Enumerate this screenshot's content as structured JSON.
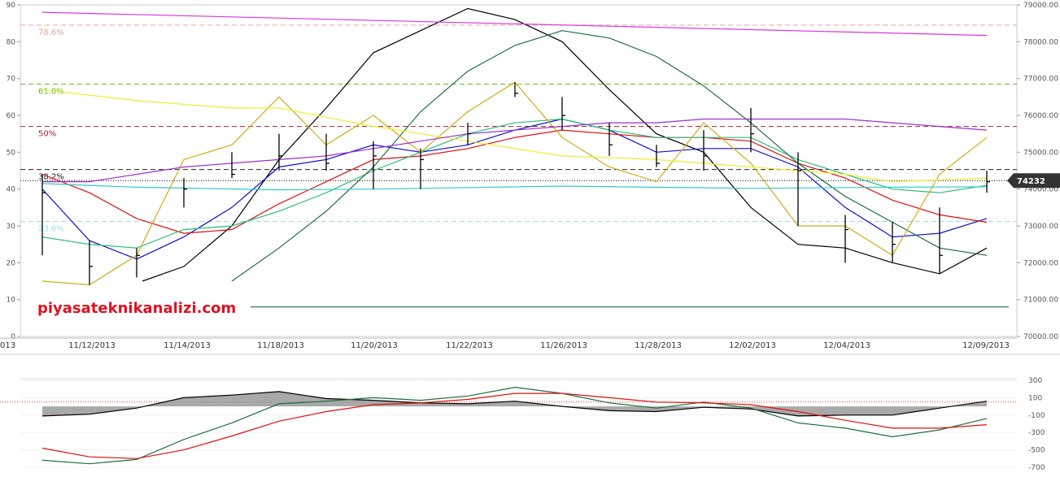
{
  "watermark": "piyasateknikanalizi.com",
  "current_price_label": "74232",
  "colors": {
    "black": "#000000",
    "blue": "#1010cc",
    "red": "#dd1111",
    "seagreen": "#2bbf7a",
    "darkgreen": "#1e6e3e",
    "gold": "#d4aa1a",
    "yellow": "#eeee33",
    "purple": "#9933cc",
    "magenta": "#dd33dd",
    "cyan": "#33cccc"
  },
  "chart_data": [
    {
      "type": "line",
      "panel": "main",
      "x_labels": [
        "013",
        "11/12/2013",
        "11/14/2013",
        "11/18/2013",
        "11/20/2013",
        "11/22/2013",
        "11/26/2013",
        "11/28/2013",
        "12/02/2013",
        "12/04/2013",
        "12/09/2013"
      ],
      "left_axis": {
        "range": [
          0,
          90
        ],
        "ticks": [
          "0",
          "10",
          "20",
          "30",
          "40",
          "50",
          "60",
          "70",
          "80",
          "90"
        ]
      },
      "right_axis": {
        "range": [
          70000,
          79000
        ],
        "ticks": [
          "70000.00",
          "71000.00",
          "72000.00",
          "73000.00",
          "74000.00",
          "75000.00",
          "76000.00",
          "77000.00",
          "78000.00",
          "79000.00"
        ]
      },
      "fib_levels": [
        {
          "label": "78.6%",
          "value": 84.5,
          "color": "#f0a0a0"
        },
        {
          "label": "61.8%",
          "value": 68.5,
          "color": "#66bb22"
        },
        {
          "label": "50%",
          "value": 57.0,
          "color": "#aa2233"
        },
        {
          "label": "38.2%",
          "value": 45.3,
          "color": "#222222"
        },
        {
          "label": "23.6%",
          "value": 31.2,
          "color": "#99ddee"
        }
      ],
      "current_price_level": 42.3,
      "candles": [
        {
          "x": 52,
          "high": 44,
          "low": 22,
          "close": 39
        },
        {
          "x": 110,
          "high": 26,
          "low": 14,
          "close": 19
        },
        {
          "x": 168,
          "high": 24,
          "low": 16,
          "close": 22
        },
        {
          "x": 226,
          "high": 43,
          "low": 35,
          "close": 40
        },
        {
          "x": 285,
          "high": 50,
          "low": 43,
          "close": 44
        },
        {
          "x": 343,
          "high": 55,
          "low": 45,
          "close": 49
        },
        {
          "x": 401,
          "high": 55,
          "low": 45,
          "close": 47
        },
        {
          "x": 459,
          "high": 53,
          "low": 40,
          "close": 49
        },
        {
          "x": 517,
          "high": 51,
          "low": 40,
          "close": 48
        },
        {
          "x": 575,
          "high": 58,
          "low": 52,
          "close": 55
        },
        {
          "x": 633,
          "high": 69,
          "low": 65,
          "close": 66
        },
        {
          "x": 691,
          "high": 65,
          "low": 56,
          "close": 60
        },
        {
          "x": 749,
          "high": 58,
          "low": 49,
          "close": 52
        },
        {
          "x": 807,
          "high": 52,
          "low": 46,
          "close": 47
        },
        {
          "x": 865,
          "high": 56,
          "low": 45,
          "close": 49
        },
        {
          "x": 923,
          "high": 62,
          "low": 50,
          "close": 55
        },
        {
          "x": 981,
          "high": 50,
          "low": 30,
          "close": 45
        },
        {
          "x": 1039,
          "high": 33,
          "low": 20,
          "close": 29
        },
        {
          "x": 1097,
          "high": 31,
          "low": 20,
          "close": 25
        },
        {
          "x": 1155,
          "high": 35,
          "low": 17,
          "close": 22
        },
        {
          "x": 1213,
          "high": 45,
          "low": 39,
          "close": 42
        }
      ],
      "series": [
        {
          "name": "",
          "color": "#000000",
          "x": [
            175,
            226,
            285,
            343,
            401,
            459,
            517,
            575,
            633,
            691,
            749,
            807,
            865,
            923,
            981,
            1039,
            1097,
            1155,
            1213
          ],
          "values": [
            15,
            19,
            30,
            48,
            62,
            77,
            83,
            89,
            86,
            80,
            67,
            55,
            50,
            35,
            25,
            24,
            20,
            17,
            24
          ]
        },
        {
          "name": "",
          "color": "#1010cc",
          "x": [
            52,
            110,
            168,
            226,
            285,
            343,
            401,
            459,
            517,
            575,
            633,
            691,
            749,
            807,
            865,
            923,
            981,
            1039,
            1097,
            1155,
            1213
          ],
          "values": [
            40,
            26,
            21,
            27,
            35,
            46,
            48,
            52,
            50,
            52,
            56,
            59,
            56,
            50,
            51,
            51,
            46,
            35,
            27,
            28,
            32
          ]
        },
        {
          "name": "",
          "color": "#dd1111",
          "x": [
            52,
            110,
            168,
            226,
            285,
            343,
            401,
            459,
            517,
            575,
            633,
            691,
            749,
            807,
            865,
            923,
            981,
            1039,
            1097,
            1155,
            1213
          ],
          "values": [
            44,
            39,
            32,
            28,
            29,
            36,
            42,
            48,
            49,
            51,
            54,
            56,
            55,
            54,
            54,
            53,
            47,
            43,
            37,
            33,
            31
          ]
        },
        {
          "name": "",
          "color": "#2bbf7a",
          "x": [
            52,
            110,
            168,
            226,
            285,
            343,
            401,
            459,
            517,
            575,
            633,
            691,
            749,
            807,
            865,
            923,
            981,
            1039,
            1097,
            1155,
            1213
          ],
          "values": [
            27,
            25,
            24,
            29,
            30,
            34,
            39,
            45,
            50,
            55,
            58,
            59,
            56,
            54,
            54,
            54,
            48,
            44,
            40,
            39,
            41
          ]
        },
        {
          "name": "",
          "color": "#1e6e3e",
          "x": [
            285,
            343,
            401,
            459,
            517,
            575,
            633,
            691,
            749,
            807,
            865,
            923,
            981,
            1039,
            1097,
            1155,
            1213
          ],
          "values": [
            15,
            24,
            34,
            46,
            61,
            72,
            79,
            83,
            81,
            76,
            68,
            58,
            47,
            38,
            31,
            24,
            22
          ]
        },
        {
          "name": "",
          "color": "#d4aa1a",
          "x": [
            52,
            110,
            168,
            226,
            285,
            343,
            401,
            459,
            517,
            575,
            633,
            691,
            749,
            807,
            865,
            923,
            981,
            1039,
            1097,
            1155,
            1213
          ],
          "values": [
            15,
            14,
            22,
            48,
            52,
            65,
            52,
            60,
            50,
            61,
            69,
            54,
            46,
            42,
            58,
            47,
            30,
            30,
            22,
            44,
            54
          ]
        },
        {
          "name": "",
          "color": "#eeee33",
          "x": [
            52,
            168,
            285,
            343,
            459,
            575,
            691,
            807,
            923,
            1039,
            1097,
            1213
          ],
          "values": [
            67,
            64,
            62,
            62,
            57,
            53,
            49,
            48,
            46,
            44,
            42,
            43
          ]
        },
        {
          "name": "",
          "color": "#9933cc",
          "x": [
            52,
            110,
            168,
            226,
            285,
            343,
            401,
            459,
            517,
            575,
            633,
            691,
            749,
            807,
            865,
            923,
            981,
            1039,
            1097,
            1155,
            1213
          ],
          "values": [
            42,
            42,
            44,
            46,
            47,
            48,
            49,
            51,
            53,
            55,
            56,
            57,
            58,
            58,
            59,
            59,
            59,
            59,
            58,
            57,
            56
          ]
        },
        {
          "name": "",
          "color": "#dd33dd",
          "x": [
            52,
            1213
          ],
          "values": [
            88,
            81.7
          ]
        },
        {
          "name": "",
          "color": "#33cccc",
          "x": [
            52,
            168,
            343,
            459,
            691,
            923,
            1097,
            1213
          ],
          "values": [
            41.5,
            40.5,
            39.8,
            40,
            40.8,
            40.2,
            40.5,
            40.6
          ]
        },
        {
          "name": "",
          "color": "#1e6e3e",
          "x": [
            308,
            1240
          ],
          "values": [
            8,
            8
          ]
        }
      ]
    },
    {
      "type": "area",
      "panel": "indicator",
      "y_axis": {
        "range": [
          -700,
          300
        ],
        "ticks": [
          "300",
          "100",
          "-100",
          "-300",
          "-500",
          "-700"
        ]
      },
      "baseline": 0,
      "reference_line": 50,
      "series": [
        {
          "name": "",
          "color": "#000000",
          "filled": true,
          "x": [
            52,
            110,
            168,
            226,
            285,
            343,
            401,
            459,
            517,
            575,
            633,
            691,
            749,
            807,
            865,
            923,
            981,
            1039,
            1097,
            1155,
            1213
          ],
          "values": [
            -110,
            -90,
            -20,
            100,
            130,
            170,
            90,
            70,
            40,
            30,
            60,
            0,
            -50,
            -60,
            -10,
            -30,
            -110,
            -100,
            -100,
            -20,
            60
          ]
        },
        {
          "name": "",
          "color": "#1e6e3e",
          "filled": false,
          "x": [
            52,
            110,
            168,
            226,
            285,
            343,
            401,
            459,
            517,
            575,
            633,
            691,
            749,
            807,
            865,
            923,
            981,
            1039,
            1097,
            1155,
            1213
          ],
          "values": [
            -620,
            -660,
            -610,
            -380,
            -190,
            30,
            60,
            100,
            70,
            120,
            220,
            150,
            40,
            -20,
            50,
            -20,
            -190,
            -250,
            -350,
            -270,
            -140
          ]
        },
        {
          "name": "",
          "color": "#dd1111",
          "filled": false,
          "x": [
            52,
            110,
            168,
            226,
            285,
            343,
            401,
            459,
            517,
            575,
            633,
            691,
            749,
            807,
            865,
            923,
            981,
            1039,
            1097,
            1155,
            1213
          ],
          "values": [
            -480,
            -580,
            -600,
            -500,
            -340,
            -170,
            -60,
            20,
            40,
            80,
            150,
            150,
            100,
            50,
            40,
            20,
            -60,
            -160,
            -250,
            -250,
            -210
          ]
        }
      ]
    }
  ]
}
